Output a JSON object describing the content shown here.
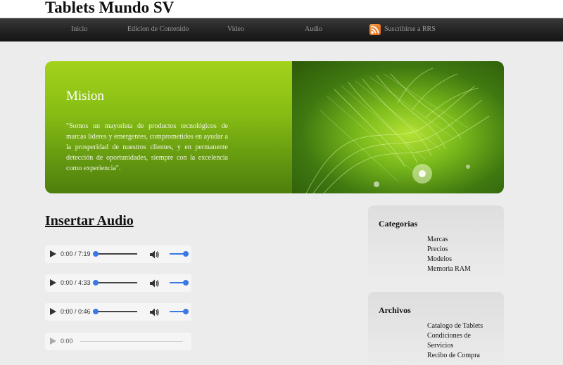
{
  "header": {
    "site_title": "Tablets Mundo SV"
  },
  "nav": {
    "items": [
      "Inicio",
      "Edicion de Contenido",
      "Video",
      "Audio"
    ],
    "rss_label": "Suscribirse a RRS"
  },
  "banner": {
    "title": "Mision",
    "text": "\"Somos un mayorista de productos tecnológicos de marcas líderes y emergentes, comprometidos en ayudar a la prosperidad de nuestros clientes, y en permanente detección de oportunidades, siempre con la excelencia como experiencia\"."
  },
  "main": {
    "title": "Insertar Audio",
    "players": [
      {
        "time": "0:00 / 7:19",
        "progress": 0,
        "volume": 1
      },
      {
        "time": "0:00 / 4:33",
        "progress": 0,
        "volume": 1
      },
      {
        "time": "0:00 / 0:46",
        "progress": 0,
        "volume": 1
      },
      {
        "time": "0:00",
        "disabled": true
      }
    ]
  },
  "sidebar": {
    "categorias": {
      "title": "Categorias",
      "items": [
        "Marcas",
        "Precios",
        "Modelos",
        "Memoria RAM"
      ]
    },
    "archivos": {
      "title": "Archivos",
      "items": [
        "Catalogo de Tablets",
        "Condiciones de",
        "Servicios",
        "Recibo de Compra"
      ]
    }
  },
  "colors": {
    "accent": "#3b78e7",
    "banner_green": "#86bd14",
    "navbar": "#262626"
  },
  "icons": [
    "rss-icon",
    "play-icon",
    "volume-icon"
  ]
}
